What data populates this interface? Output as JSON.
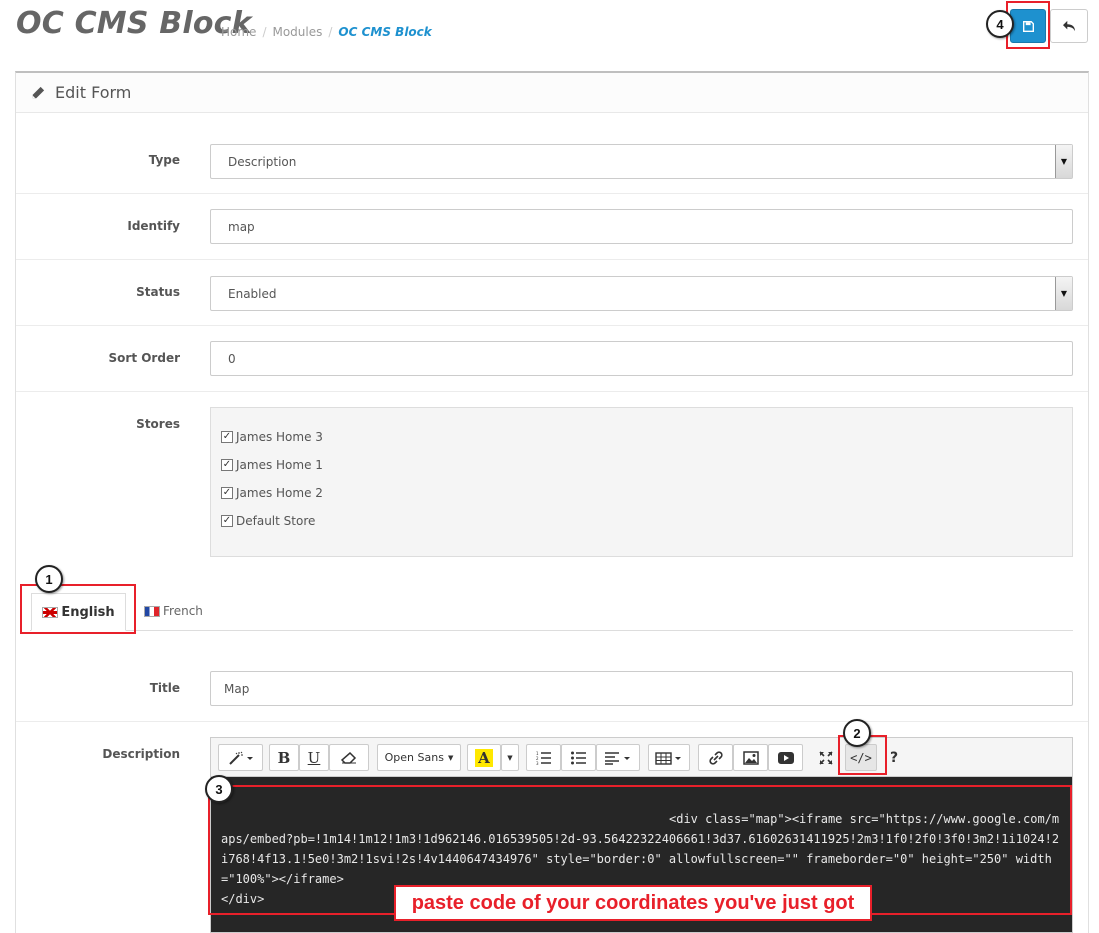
{
  "header": {
    "title": "OC CMS Block",
    "breadcrumb": [
      "Home",
      "Modules",
      "OC CMS Block"
    ]
  },
  "panel": {
    "heading": "Edit Form"
  },
  "form": {
    "type": {
      "label": "Type",
      "value": "Description"
    },
    "identify": {
      "label": "Identify",
      "value": "map"
    },
    "status": {
      "label": "Status",
      "value": "Enabled"
    },
    "sort_order": {
      "label": "Sort Order",
      "value": "0"
    },
    "stores": {
      "label": "Stores",
      "items": [
        "James Home 3",
        "James Home 1",
        "James Home 2",
        "Default Store"
      ]
    },
    "tabs": [
      "English",
      "French"
    ],
    "title": {
      "label": "Title",
      "value": "Map"
    },
    "description": {
      "label": "Description",
      "font_select": "Open Sans",
      "code": "<div class=\"map\"><iframe src=\"https://www.google.com/maps/embed?pb=!1m14!1m12!1m3!1d962146.016539505!2d-93.56422322406661!3d37.61602631411925!2m3!1f0!2f0!3f0!3m2!1i1024!2i768!4f13.1!5e0!3m2!1svi!2s!4v1440647434976\" style=\"border:0\" allowfullscreen=\"\" frameborder=\"0\" height=\"250\" width=\"100%\"></iframe>\n</div>"
    }
  },
  "annotations": {
    "markers": [
      "1",
      "2",
      "3",
      "4"
    ],
    "callout": "paste code of your coordinates you've just got"
  },
  "colors": {
    "primary": "#1e91cf",
    "annotation": "#e8202a"
  }
}
